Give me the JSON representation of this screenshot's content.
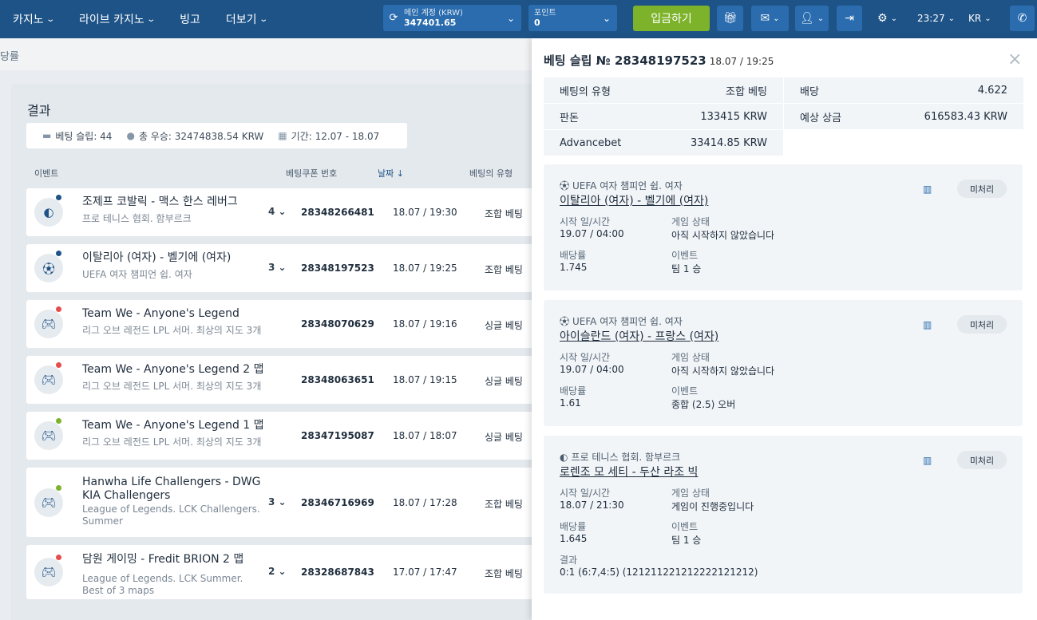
{
  "nav": {
    "items": [
      "카지노",
      "라이브 카지노",
      "빙고",
      "더보기"
    ],
    "account_label": "메인 계정 (KRW)",
    "account_balance": "347401.65",
    "points_label": "포인트",
    "points_value": "0",
    "deposit_label": "입금하기",
    "time": "23:27",
    "lang": "KR"
  },
  "breadcrumb": "당률",
  "results": {
    "title": "결과",
    "stats": {
      "slips": "베팅 슬립: 44",
      "total": "총 우승: 32474838.54 KRW",
      "period": "기간: 12.07 - 18.07"
    },
    "columns": [
      "이벤트",
      "베팅쿠폰 번호",
      "날짜",
      "베팅의 유형"
    ],
    "rows": [
      {
        "title": "조제프 코발릭 - 맥스 한스 레버그",
        "sub": "프로 테니스 협회. 함부르크",
        "count": "4",
        "coupon": "28348266481",
        "date": "18.07 / 19:30",
        "type": "조합 베팅",
        "icon": "tennis-ball-icon",
        "dot": "#1e5387"
      },
      {
        "title": "이탈리아 (여자) - 벨기에 (여자)",
        "sub": "UEFA 여자 챔피언 쉽. 여자",
        "count": "3",
        "coupon": "28348197523",
        "date": "18.07 / 19:25",
        "type": "조합 베팅",
        "icon": "soccer-ball-icon",
        "dot": "#1e5387"
      },
      {
        "title": "Team We - Anyone's Legend",
        "sub": "리그 오브 레전드 LPL 서머. 최상의 지도 3개",
        "count": "",
        "coupon": "28348070629",
        "date": "18.07 / 19:16",
        "type": "싱글 베팅",
        "icon": "gamepad-icon",
        "dot": "#e84b4b"
      },
      {
        "title": "Team We - Anyone's Legend 2 맵",
        "sub": "리그 오브 레전드 LPL 서머. 최상의 지도 3개",
        "count": "",
        "coupon": "28348063651",
        "date": "18.07 / 19:15",
        "type": "싱글 베팅",
        "icon": "gamepad-icon",
        "dot": "#e84b4b"
      },
      {
        "title": "Team We - Anyone's Legend 1 맵",
        "sub": "리그 오브 레전드 LPL 서머. 최상의 지도 3개",
        "count": "",
        "coupon": "28347195087",
        "date": "18.07 / 18:07",
        "type": "싱글 베팅",
        "icon": "gamepad-icon",
        "dot": "#7db32a"
      },
      {
        "title": "Hanwha Life Challengers - DWG KIA Challengers",
        "sub": "League of Legends. LCK Challengers. Summer",
        "count": "3",
        "coupon": "28346716969",
        "date": "18.07 / 17:28",
        "type": "조합 베팅",
        "icon": "gamepad-icon",
        "dot": "#7db32a"
      },
      {
        "title": "담원 게이밍 - Fredit BRION 2 맵",
        "sub": "League of Legends. LCK Summer. Best of 3 maps",
        "count": "2",
        "coupon": "28328687843",
        "date": "17.07 / 17:47",
        "type": "조합 베팅",
        "icon": "gamepad-icon",
        "dot": "#e84b4b"
      }
    ]
  },
  "slip": {
    "title": "베팅 슬립 № 28348197523",
    "timestamp": "18.07 / 19:25",
    "summary": {
      "type_label": "베팅의 유형",
      "type_value": "조합 베팅",
      "odds_label": "배당",
      "odds_value": "4.622",
      "stake_label": "판돈",
      "stake_value": "133415 KRW",
      "payout_label": "예상 상금",
      "payout_value": "616583.43 KRW",
      "advance_label": "Advancebet",
      "advance_value": "33414.85 KRW"
    },
    "labels": {
      "start": "시작 일/시간",
      "state": "게임 상태",
      "odds": "배당률",
      "event": "이벤트",
      "result": "결과",
      "pending": "미처리"
    },
    "events": [
      {
        "league": "UEFA 여자 챔피언 쉽. 여자",
        "match": "이탈리아 (여자) - 벨기에 (여자)",
        "start": "19.07 / 04:00",
        "state": "아직 시작하지 않았습니다",
        "odds": "1.745",
        "event": "팀 1 승",
        "icon": "soccer-ball-icon"
      },
      {
        "league": "UEFA 여자 챔피언 쉽. 여자",
        "match": "아이슬란드 (여자) - 프랑스 (여자)",
        "start": "19.07 / 04:00",
        "state": "아직 시작하지 않았습니다",
        "odds": "1.61",
        "event": "종합 (2.5) 오버",
        "icon": "soccer-ball-icon"
      },
      {
        "league": "프로 테니스 협회. 함부르크",
        "match": "로렌조 모 세티 - 두산 라조 빅",
        "start": "18.07 / 21:30",
        "state": "게임이 진행중입니다",
        "odds": "1.645",
        "event": "팀 1 승",
        "result": "0:1 (6:7,4:5) (121211221212222121212)",
        "icon": "tennis-ball-icon"
      }
    ]
  }
}
